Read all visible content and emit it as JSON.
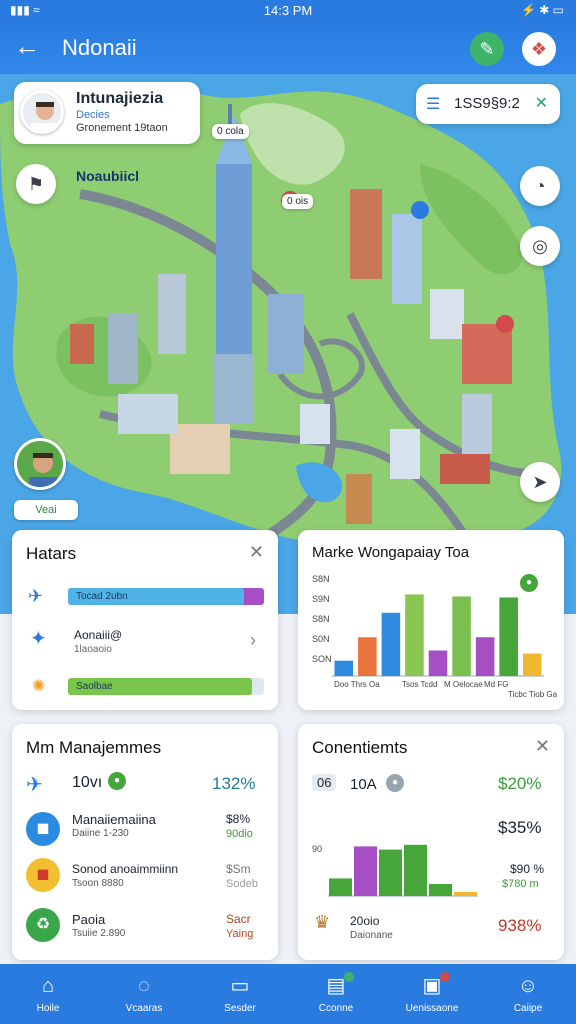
{
  "status_bar": {
    "time": "14:3 PM"
  },
  "app_bar": {
    "title": "Ndonaii"
  },
  "profile_card": {
    "name": "Intunajiezia",
    "subtitle": "Decies",
    "detail": "Gronement 19taon"
  },
  "search_card": {
    "value": "1SS9§9:2"
  },
  "map": {
    "location_label": "Noaubiicl",
    "tags": [
      "0 cola",
      "0 ois"
    ],
    "user_tag": "Veai"
  },
  "panels": {
    "hatars": {
      "title": "Hatars",
      "bars": [
        {
          "label": "Tocad 2ubn",
          "fill_fraction": 0.9
        },
        {
          "label": "Aonaiii@",
          "sub": "1laoaoio"
        },
        {
          "label": "Saolbae",
          "fill_fraction": 0.94
        }
      ]
    },
    "marke_chart": {
      "title": "Marke Wongapaiay Toa",
      "y_ticks": [
        "S8N",
        "S9N",
        "S8N",
        "S0N",
        "SON"
      ],
      "x_labels": [
        "Doo Thrs Oa",
        "Tsos Tcdd",
        "M Oelocae",
        "Md FG",
        "Ticbc Tiob Ga"
      ]
    },
    "management": {
      "title": "Mm Manajemmes",
      "header_value": "10vı",
      "header_percent": "132%",
      "rows": [
        {
          "title": "Manaiiemaiina",
          "sub": "Daiine 1-230",
          "v1": "$8%",
          "v2": "90dio"
        },
        {
          "title": "Sonod anoaimmiinn",
          "sub": "Tsoon 8880",
          "v1": "$Sm",
          "v2": "Sodeb"
        },
        {
          "title": "Paoia",
          "sub": "Tsuiie 2.890",
          "v1": "Sacr",
          "v2": "Yaing"
        }
      ]
    },
    "conentiemts": {
      "title": "Conentiemts",
      "header_chip": "06",
      "header_value": "10A",
      "header_percent": "$20%",
      "mid_percent": "$35%",
      "y_tick": "90",
      "side_values": [
        "$90 %",
        "$780 m"
      ],
      "footer_label": "20oio",
      "footer_sub": "Daionane",
      "footer_percent": "938%"
    }
  },
  "chart_data": {
    "type": "bar",
    "title": "Marke Wongapaiay Toa",
    "categories": [
      "1",
      "2",
      "3",
      "4",
      "5",
      "6",
      "7",
      "8",
      "9"
    ],
    "values": [
      15,
      38,
      62,
      80,
      25,
      78,
      38,
      77,
      22
    ],
    "colors": [
      "#2f8be0",
      "#e8743b",
      "#2f8be0",
      "#8ac750",
      "#a64fc4",
      "#79c050",
      "#a64fc4",
      "#46a63a",
      "#f0b830"
    ],
    "ylim": [
      0,
      100
    ]
  },
  "chart_data_2": {
    "type": "bar",
    "values": [
      22,
      62,
      58,
      64,
      15,
      5
    ],
    "colors": [
      "#46a63a",
      "#a64fc4",
      "#46a63a",
      "#46a63a",
      "#46a63a",
      "#f0b830"
    ],
    "ylim": [
      0,
      100
    ]
  },
  "bottom_nav": [
    {
      "label": "Hoile",
      "icon": "home-icon"
    },
    {
      "label": "Vcaaras",
      "icon": "chat-icon"
    },
    {
      "label": "Sesder",
      "icon": "book-icon"
    },
    {
      "label": "Cconne",
      "icon": "briefcase-icon"
    },
    {
      "label": "Uenissaone",
      "icon": "folder-icon"
    },
    {
      "label": "Caiipe",
      "icon": "person-icon"
    }
  ],
  "colors": {
    "primary": "#2a7be0",
    "water": "#4aa6e6",
    "land": "#8fcd72",
    "green": "#27a563"
  }
}
